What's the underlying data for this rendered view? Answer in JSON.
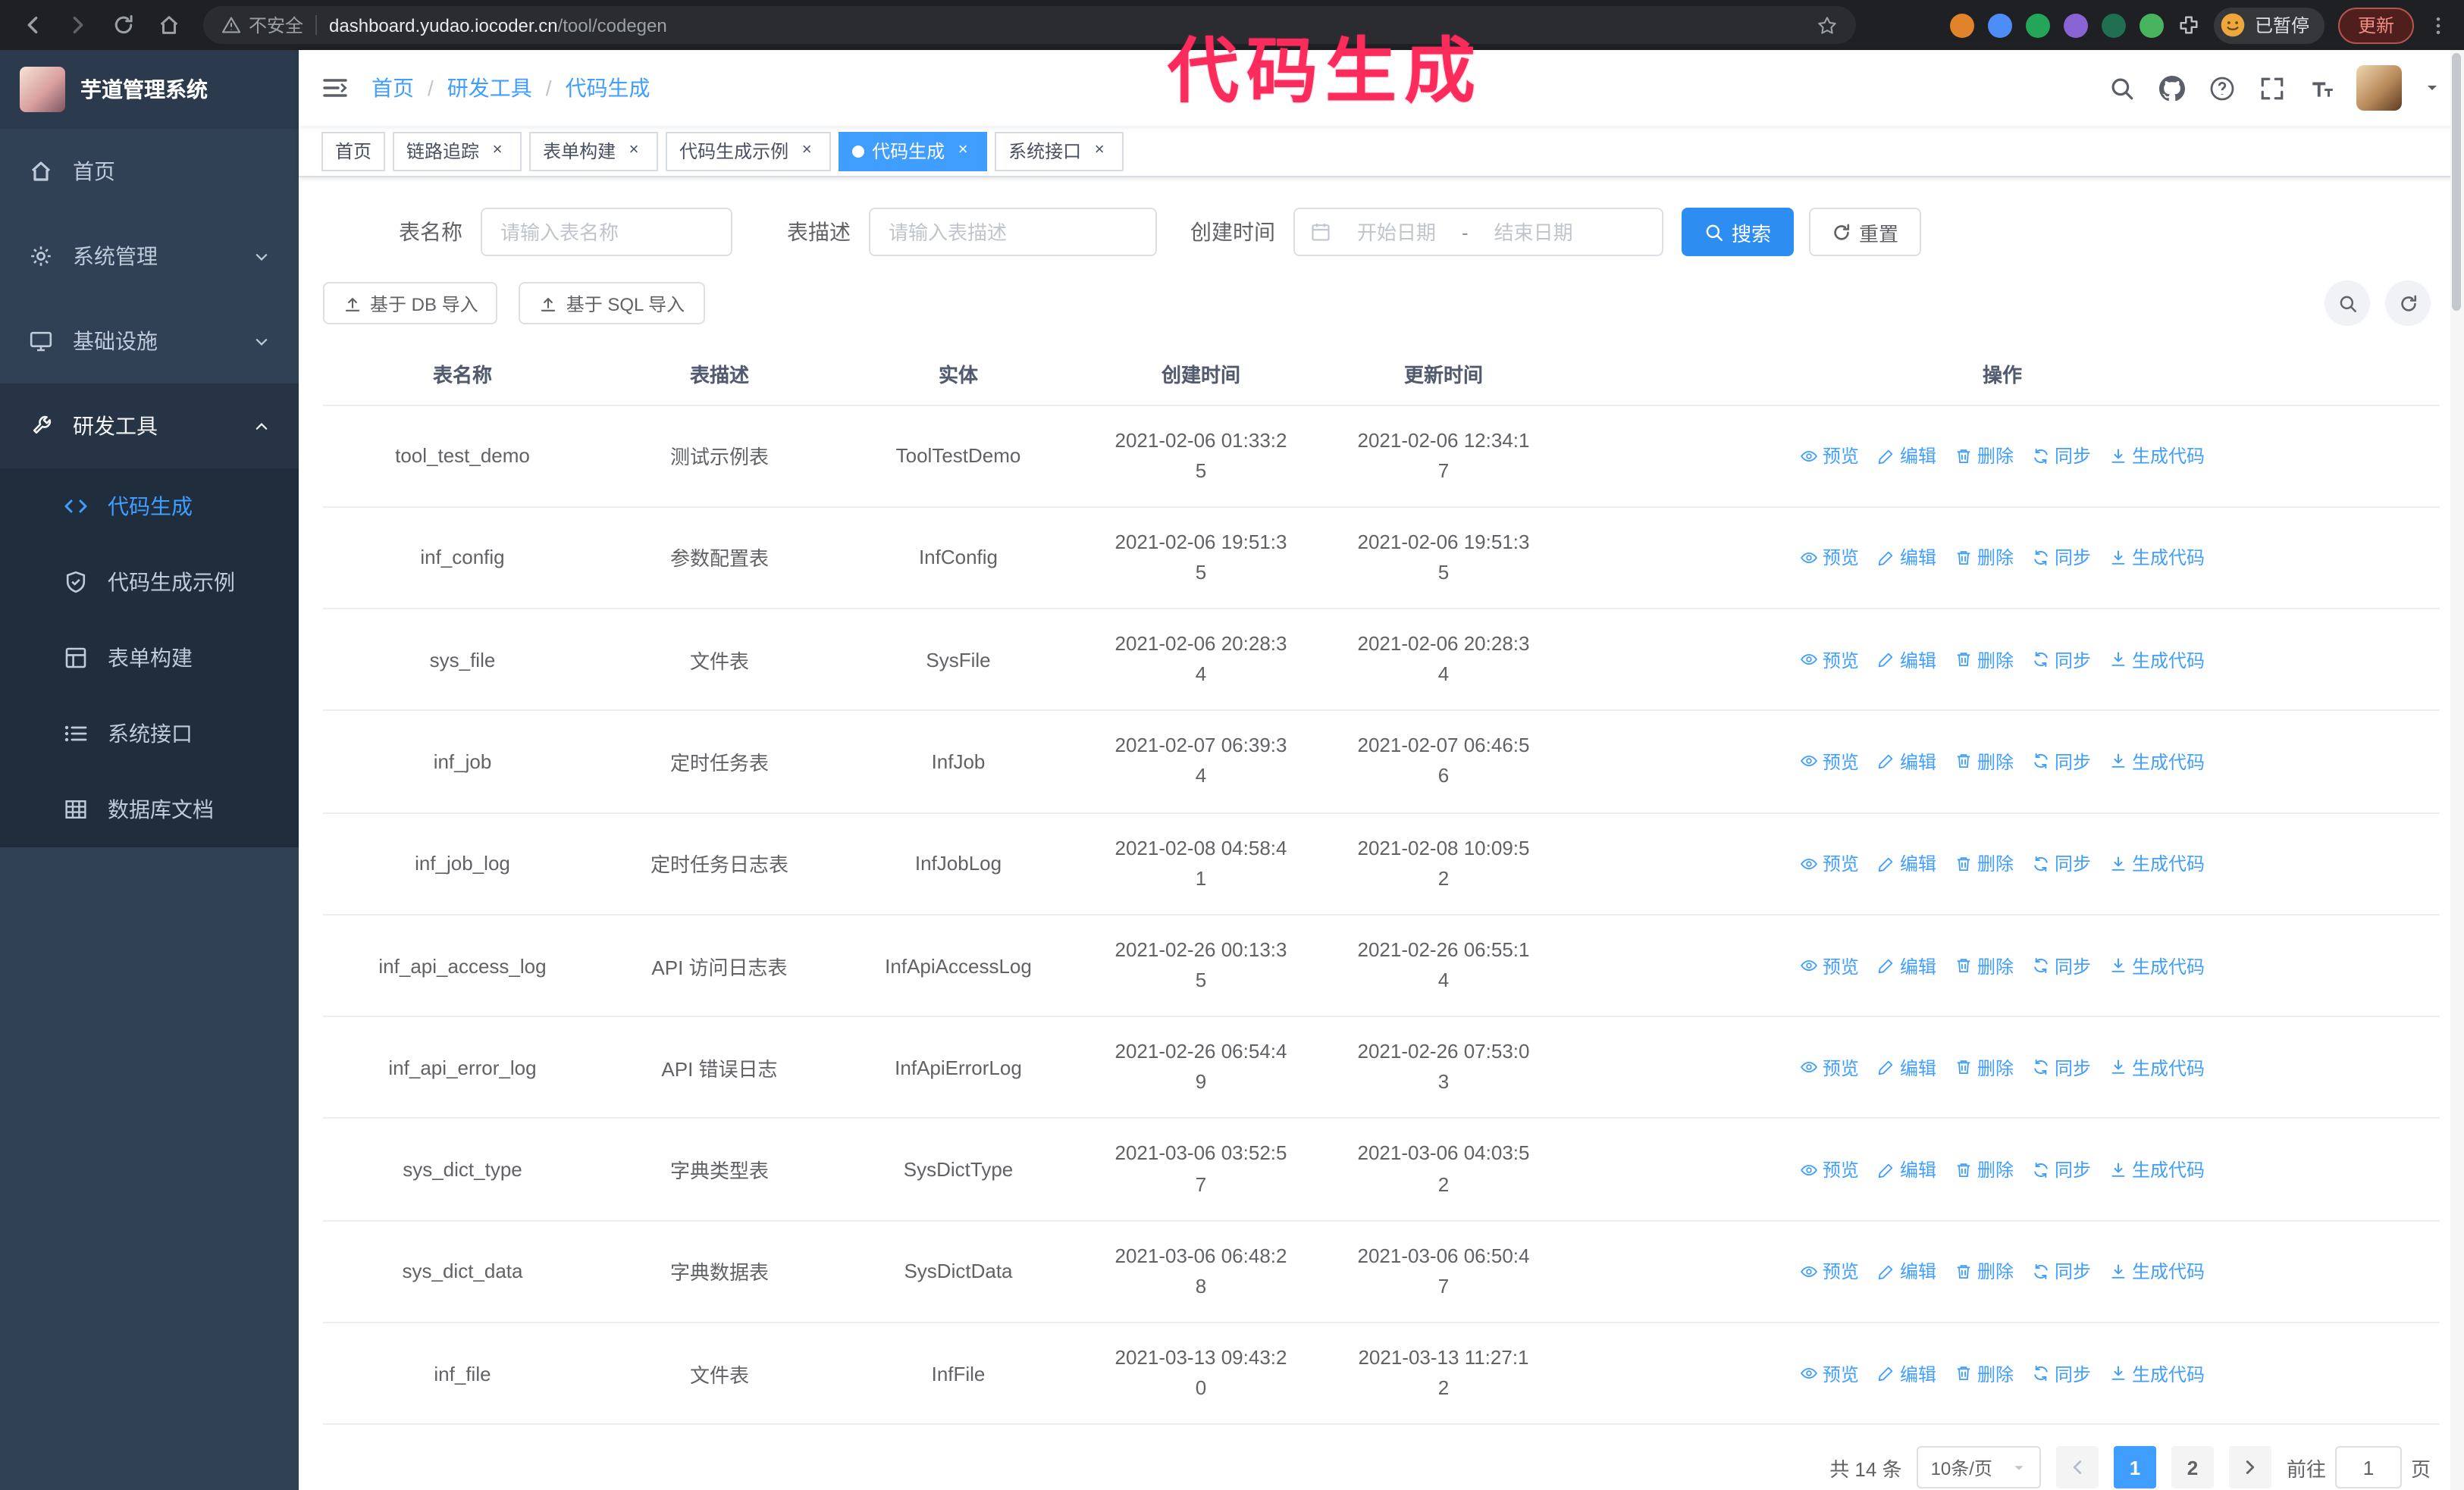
{
  "annotation": "代码生成",
  "browser": {
    "security_warning": "不安全",
    "url_host": "dashboard.yudao.iocoder.cn",
    "url_path": "/tool/codegen",
    "extensions": [
      {
        "name": "extension-icon",
        "color": "#e0832b"
      },
      {
        "name": "extension-icon",
        "color": "#4d8df7"
      },
      {
        "name": "extension-icon",
        "color": "#23a55a"
      },
      {
        "name": "extension-icon",
        "color": "#8a63d2"
      },
      {
        "name": "extension-icon",
        "color": "#1f6f50"
      },
      {
        "name": "extension-icon",
        "color": "#49b45f"
      }
    ],
    "profile_badge": "已暂停",
    "update_button": "更新"
  },
  "sidebar": {
    "logo_title": "芋道管理系统",
    "items": [
      {
        "key": "home",
        "label": "首页",
        "icon": "home",
        "expandable": false,
        "expanded": false,
        "active": false
      },
      {
        "key": "system",
        "label": "系统管理",
        "icon": "gear",
        "expandable": true,
        "expanded": false,
        "active": false
      },
      {
        "key": "infra",
        "label": "基础设施",
        "icon": "monitor",
        "expandable": true,
        "expanded": false,
        "active": false
      },
      {
        "key": "devtools",
        "label": "研发工具",
        "icon": "tool",
        "expandable": true,
        "expanded": true,
        "active": true
      }
    ],
    "submenu": [
      {
        "key": "codegen",
        "label": "代码生成",
        "icon": "code",
        "active": true
      },
      {
        "key": "codegen-example",
        "label": "代码生成示例",
        "icon": "shield",
        "active": false
      },
      {
        "key": "form-builder",
        "label": "表单构建",
        "icon": "form",
        "active": false
      },
      {
        "key": "system-api",
        "label": "系统接口",
        "icon": "api",
        "active": false
      },
      {
        "key": "db-doc",
        "label": "数据库文档",
        "icon": "db",
        "active": false
      }
    ]
  },
  "breadcrumb": {
    "separator": "/",
    "items": [
      "首页",
      "研发工具",
      "代码生成"
    ]
  },
  "navbar": {
    "icons": [
      "search",
      "github",
      "help",
      "fullscreen",
      "font-size"
    ]
  },
  "tabs": [
    {
      "key": "home",
      "label": "首页",
      "closable": false,
      "active": false
    },
    {
      "key": "trace",
      "label": "链路追踪",
      "closable": true,
      "active": false
    },
    {
      "key": "form-builder",
      "label": "表单构建",
      "closable": true,
      "active": false
    },
    {
      "key": "codegen-example",
      "label": "代码生成示例",
      "closable": true,
      "active": false
    },
    {
      "key": "codegen",
      "label": "代码生成",
      "closable": true,
      "active": true
    },
    {
      "key": "system-api",
      "label": "系统接口",
      "closable": true,
      "active": false
    }
  ],
  "filters": {
    "table_name_label": "表名称",
    "table_name_placeholder": "请输入表名称",
    "table_desc_label": "表描述",
    "table_desc_placeholder": "请输入表描述",
    "create_time_label": "创建时间",
    "start_date_placeholder": "开始日期",
    "range_separator": "-",
    "end_date_placeholder": "结束日期",
    "search_button": "搜索",
    "reset_button": "重置"
  },
  "toolbar": {
    "import_db": "基于 DB 导入",
    "import_sql": "基于 SQL 导入"
  },
  "table": {
    "columns": [
      "表名称",
      "表描述",
      "实体",
      "创建时间",
      "更新时间",
      "操作"
    ],
    "actions": [
      {
        "key": "preview",
        "label": "预览",
        "icon": "eye"
      },
      {
        "key": "edit",
        "label": "编辑",
        "icon": "edit"
      },
      {
        "key": "delete",
        "label": "删除",
        "icon": "trash"
      },
      {
        "key": "sync",
        "label": "同步",
        "icon": "sync"
      },
      {
        "key": "generate-code",
        "label": "生成代码",
        "icon": "download"
      }
    ],
    "rows": [
      {
        "name": "tool_test_demo",
        "desc": "测试示例表",
        "entity": "ToolTestDemo",
        "created": "2021-02-06 01:33:25",
        "updated": "2021-02-06 12:34:17"
      },
      {
        "name": "inf_config",
        "desc": "参数配置表",
        "entity": "InfConfig",
        "created": "2021-02-06 19:51:35",
        "updated": "2021-02-06 19:51:35"
      },
      {
        "name": "sys_file",
        "desc": "文件表",
        "entity": "SysFile",
        "created": "2021-02-06 20:28:34",
        "updated": "2021-02-06 20:28:34"
      },
      {
        "name": "inf_job",
        "desc": "定时任务表",
        "entity": "InfJob",
        "created": "2021-02-07 06:39:34",
        "updated": "2021-02-07 06:46:56"
      },
      {
        "name": "inf_job_log",
        "desc": "定时任务日志表",
        "entity": "InfJobLog",
        "created": "2021-02-08 04:58:41",
        "updated": "2021-02-08 10:09:52"
      },
      {
        "name": "inf_api_access_log",
        "desc": "API 访问日志表",
        "entity": "InfApiAccessLog",
        "created": "2021-02-26 00:13:35",
        "updated": "2021-02-26 06:55:14"
      },
      {
        "name": "inf_api_error_log",
        "desc": "API 错误日志",
        "entity": "InfApiErrorLog",
        "created": "2021-02-26 06:54:49",
        "updated": "2021-02-26 07:53:03"
      },
      {
        "name": "sys_dict_type",
        "desc": "字典类型表",
        "entity": "SysDictType",
        "created": "2021-03-06 03:52:57",
        "updated": "2021-03-06 04:03:52"
      },
      {
        "name": "sys_dict_data",
        "desc": "字典数据表",
        "entity": "SysDictData",
        "created": "2021-03-06 06:48:28",
        "updated": "2021-03-06 06:50:47"
      },
      {
        "name": "inf_file",
        "desc": "文件表",
        "entity": "InfFile",
        "created": "2021-03-13 09:43:20",
        "updated": "2021-03-13 11:27:12"
      }
    ]
  },
  "pagination": {
    "total_text": "共 14 条",
    "page_size": "10条/页",
    "pages": [
      "1",
      "2"
    ],
    "active_page": "1",
    "goto_prefix": "前往",
    "goto_value": "1",
    "goto_suffix": "页"
  },
  "colors": {
    "accent": "#409eff",
    "sidebar_bg": "#304156",
    "submenu_bg": "#1f2d3d",
    "annotation": "#fb2c5c"
  }
}
